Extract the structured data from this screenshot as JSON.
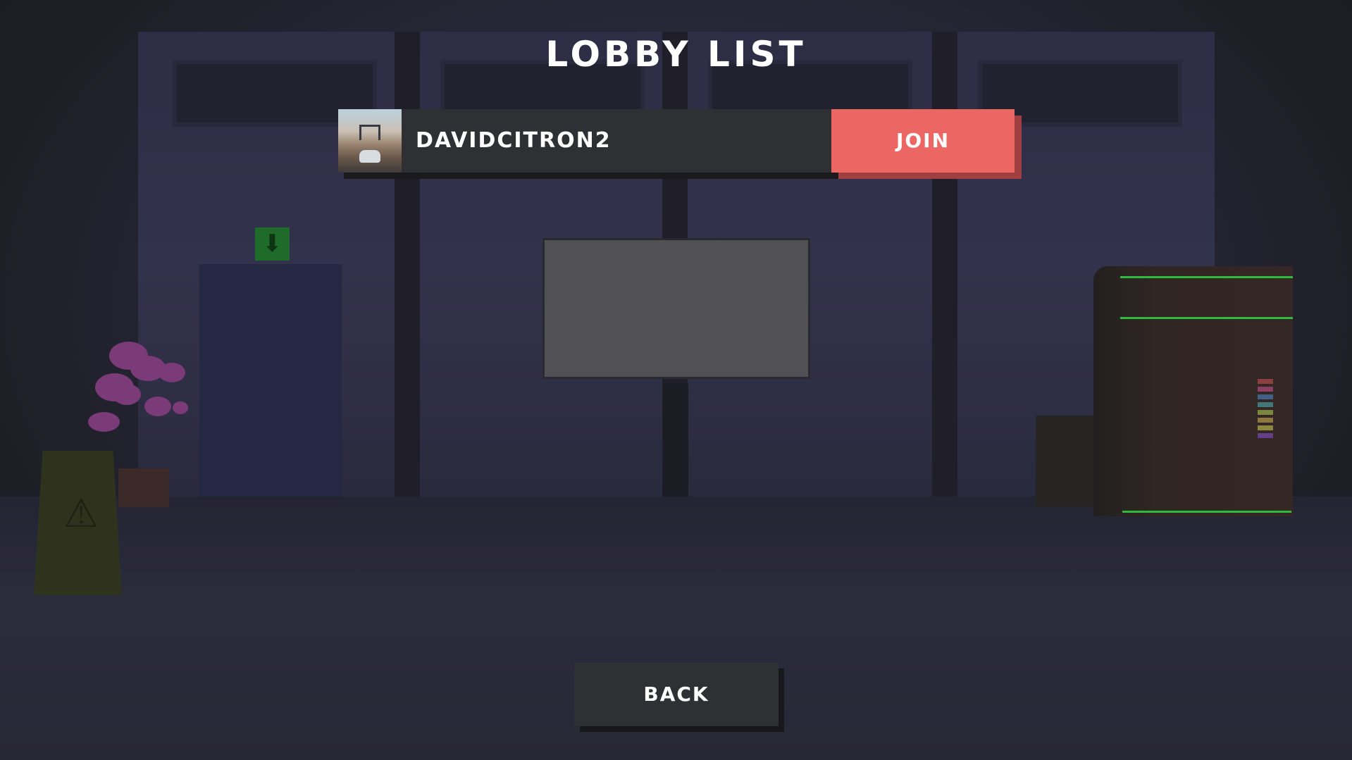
{
  "screen": {
    "title": "LOBBY LIST"
  },
  "lobbies": [
    {
      "name": "DAVIDCITRON2",
      "thumbnail": "lobby-map-thumbnail",
      "join_label": "JOIN"
    }
  ],
  "footer": {
    "back_label": "BACK"
  },
  "colors": {
    "join_button": "#ec6663",
    "row_background": "#2e3033",
    "back_button": "#2e3033",
    "text": "#ffffff"
  },
  "icons": {
    "exit_sign": "down-arrow-icon",
    "wet_floor_sign": "warning-icon"
  }
}
